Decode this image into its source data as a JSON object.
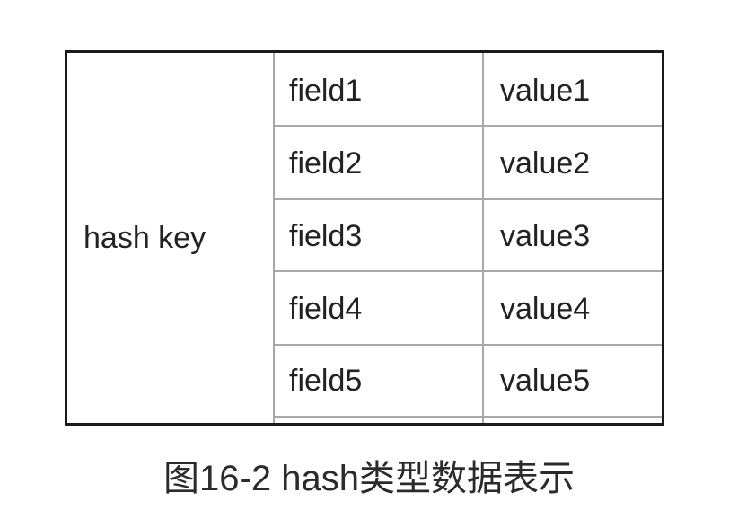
{
  "table": {
    "key": "hash key",
    "rows": [
      {
        "field": "field1",
        "value": "value1"
      },
      {
        "field": "field2",
        "value": "value2"
      },
      {
        "field": "field3",
        "value": "value3"
      },
      {
        "field": "field4",
        "value": "value4"
      },
      {
        "field": "field5",
        "value": "value5"
      }
    ]
  },
  "caption": "图16-2 hash类型数据表示",
  "colors": {
    "outer_border": "#1a1a1a",
    "inner_border": "#a8a8a8",
    "text": "#222222"
  }
}
